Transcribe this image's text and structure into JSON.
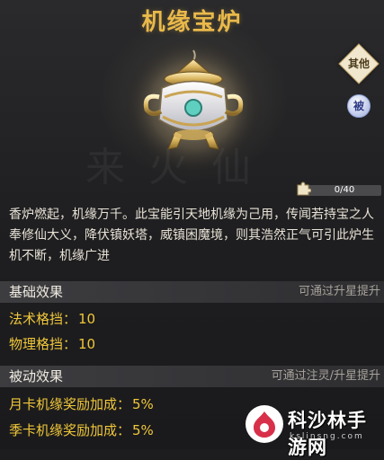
{
  "item": {
    "title": "机缘宝炉",
    "quality_badge": "其他",
    "type_badge": "被",
    "fragments": {
      "label": "0/40",
      "current": 0,
      "total": 40
    },
    "description": "香炉燃起，机缘万千。此宝能引天地机缘为己用，传闻若持宝之人奉修仙大义，降伏镇妖塔，威镇困魔境，则其浩然正气可引此炉生机不断，机缘广进"
  },
  "basic_effect": {
    "heading": "基础效果",
    "hint": "可通过升星提升",
    "stats": [
      {
        "label": "法术格挡：",
        "value": "10"
      },
      {
        "label": "物理格挡：",
        "value": "10"
      }
    ]
  },
  "passive_effect": {
    "heading": "被动效果",
    "hint": "可通过注灵/升星提升",
    "stats": [
      {
        "label": "月卡机缘奖励加成：",
        "value": "5%"
      },
      {
        "label": "季卡机缘奖励加成：",
        "value": "5%"
      }
    ]
  },
  "watermark": {
    "name": "科沙林手游网",
    "url": "kslinsng.com"
  },
  "colors": {
    "title": "#e9b94a",
    "stat": "#f0c73a",
    "accent_bar": "#d8b25a"
  },
  "icons": [
    "incense-burner-icon",
    "puzzle-piece-icon",
    "site-logo-icon"
  ]
}
